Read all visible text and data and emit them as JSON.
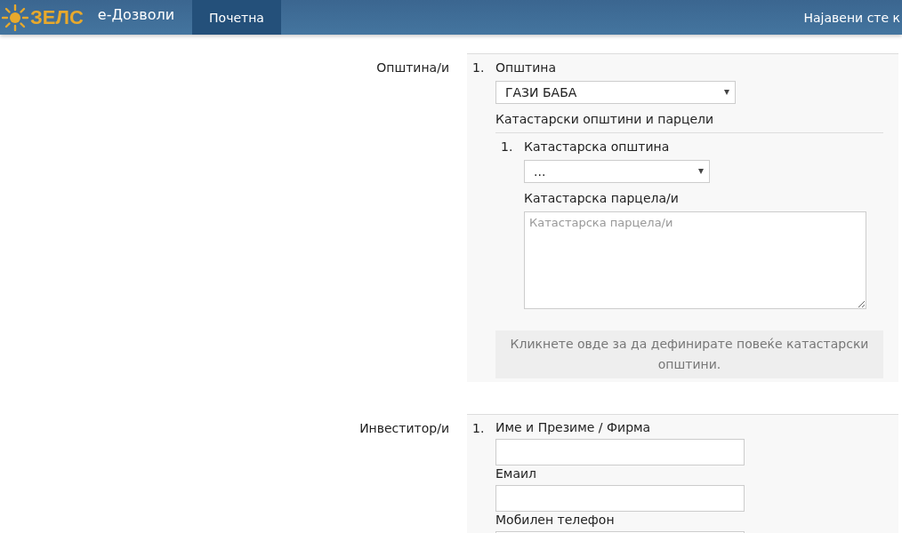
{
  "header": {
    "logo": "ЗЕЛС",
    "app_name": "е-Дозволи",
    "nav": [
      {
        "label": "Почетна",
        "selected": true
      }
    ],
    "user": "Најавени сте к"
  },
  "sections": [
    {
      "label": "Општина/и",
      "items": [
        {
          "number": "1.",
          "fields": [
            {
              "kind": "select",
              "label": "Општина",
              "value": "ГАЗИ БАБА"
            },
            {
              "kind": "subsection",
              "title": "Катастарски општини и парцели",
              "items": [
                {
                  "number": "1.",
                  "fields": [
                    {
                      "kind": "select",
                      "label": "Катастарска општина",
                      "value": "..."
                    },
                    {
                      "kind": "textarea",
                      "label": "Катастарска парцела/и",
                      "placeholder": "Катастарска парцела/и"
                    }
                  ]
                }
              ],
              "add_button": "Кликнете овде за да дефинирате повеќе катастарски општини."
            }
          ]
        }
      ]
    },
    {
      "label": "Инвеститор/и",
      "items": [
        {
          "number": "1.",
          "fields": [
            {
              "kind": "text",
              "label": "Име и Презиме / Фирма"
            },
            {
              "kind": "text",
              "label": "Емаил"
            },
            {
              "kind": "text",
              "label": "Мобилен телефон"
            }
          ]
        }
      ]
    }
  ]
}
